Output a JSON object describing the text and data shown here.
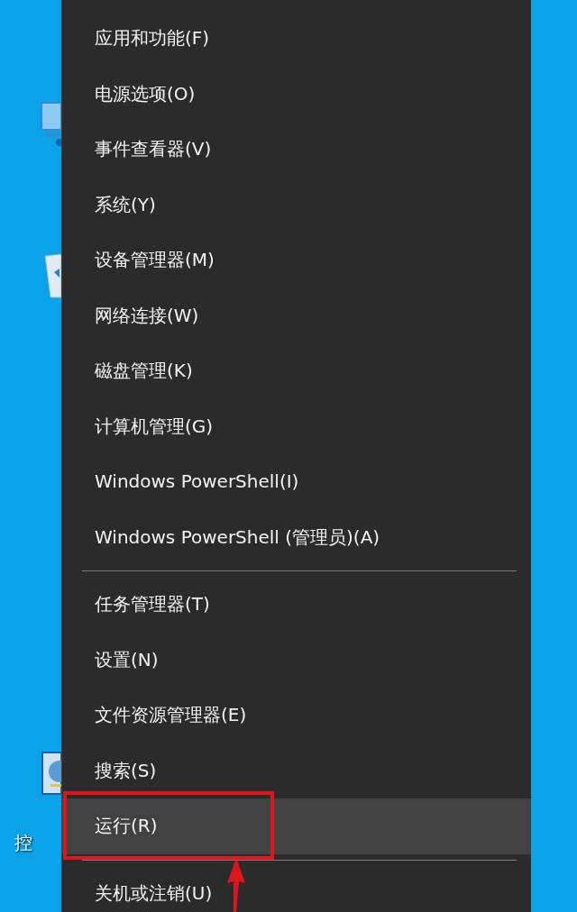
{
  "desktop": {
    "icon_label": "控"
  },
  "menu": {
    "groups": [
      [
        {
          "label": "应用和功能(F)",
          "selected": false
        },
        {
          "label": "电源选项(O)",
          "selected": false
        },
        {
          "label": "事件查看器(V)",
          "selected": false
        },
        {
          "label": "系统(Y)",
          "selected": false
        },
        {
          "label": "设备管理器(M)",
          "selected": false
        },
        {
          "label": "网络连接(W)",
          "selected": false
        },
        {
          "label": "磁盘管理(K)",
          "selected": false
        },
        {
          "label": "计算机管理(G)",
          "selected": false
        },
        {
          "label": "Windows PowerShell(I)",
          "selected": false
        },
        {
          "label": "Windows PowerShell (管理员)(A)",
          "selected": false
        }
      ],
      [
        {
          "label": "任务管理器(T)",
          "selected": false
        },
        {
          "label": "设置(N)",
          "selected": false
        },
        {
          "label": "文件资源管理器(E)",
          "selected": false
        },
        {
          "label": "搜索(S)",
          "selected": false
        },
        {
          "label": "运行(R)",
          "selected": true
        }
      ],
      [
        {
          "label": "关机或注销(U)",
          "selected": false
        }
      ]
    ]
  }
}
